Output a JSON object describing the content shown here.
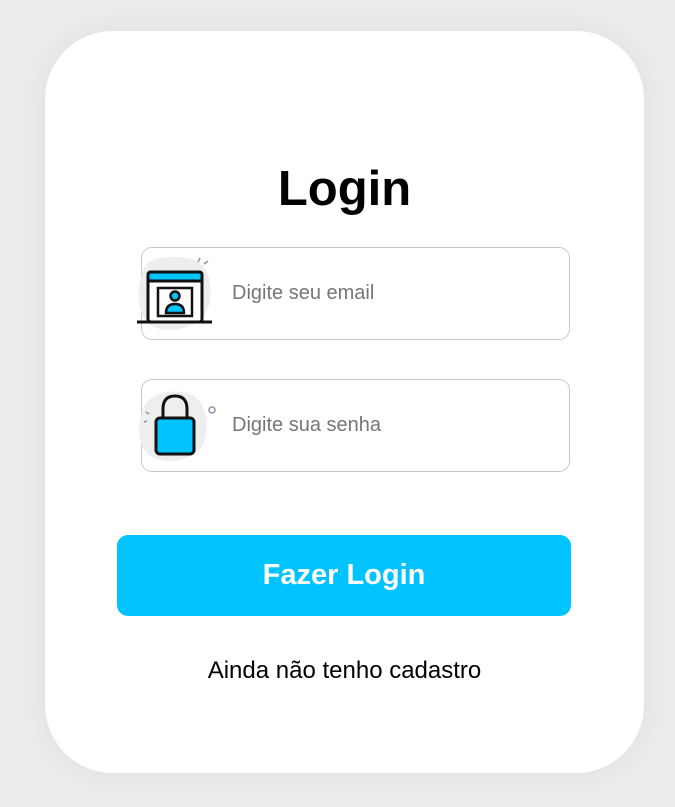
{
  "login": {
    "title": "Login",
    "email_placeholder": "Digite seu email",
    "password_placeholder": "Digite sua senha",
    "submit_label": "Fazer Login",
    "signup_link": "Ainda não tenho cadastro"
  },
  "icons": {
    "email": "user-profile-window-icon",
    "password": "padlock-icon"
  },
  "colors": {
    "accent": "#00c3ff",
    "page_background": "#ececec",
    "card_background": "#ffffff",
    "field_border": "#c9c9c9"
  }
}
